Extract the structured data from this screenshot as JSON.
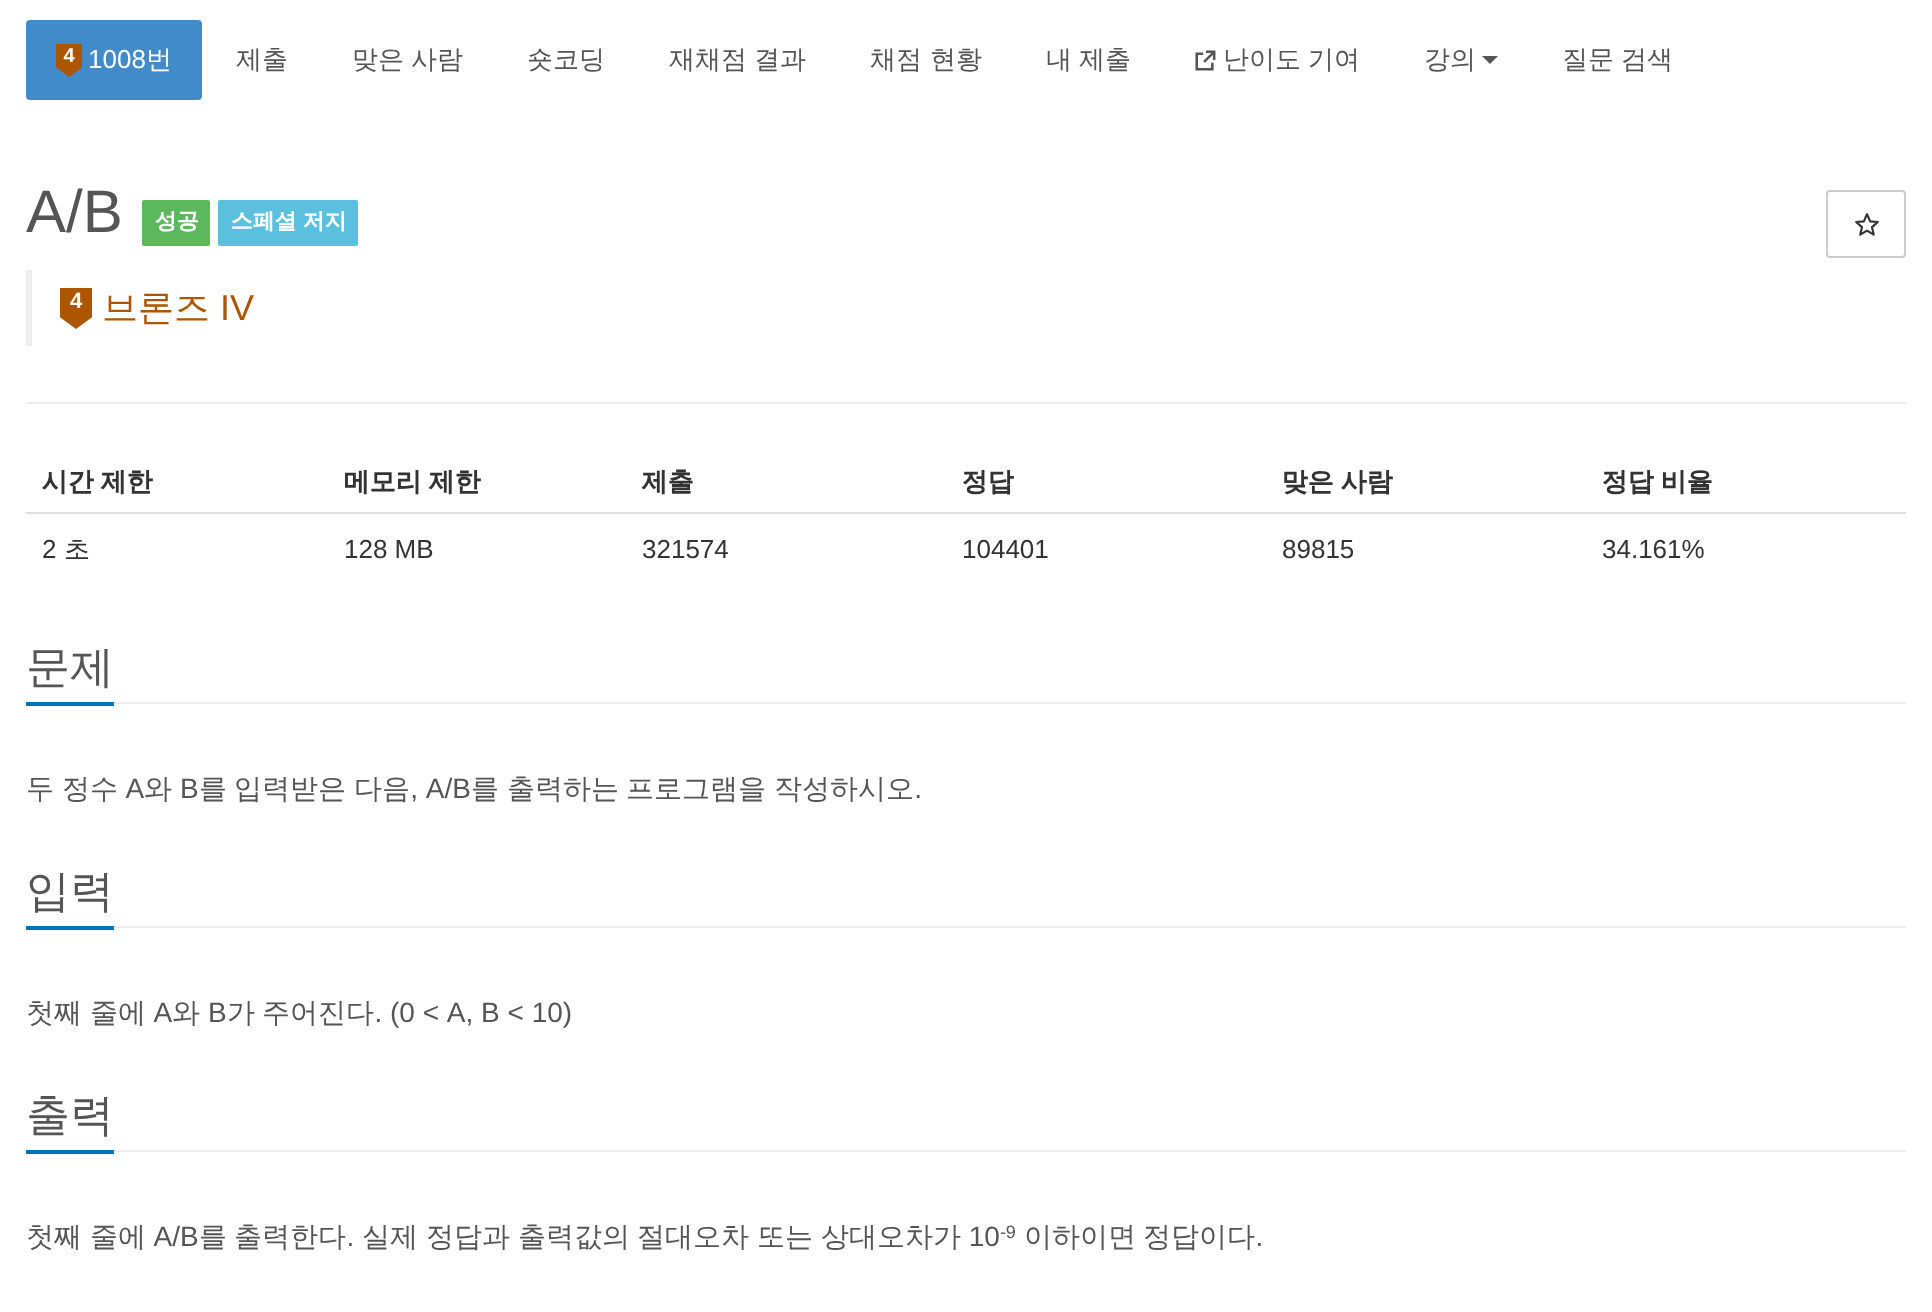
{
  "nav": {
    "items": [
      {
        "kind": "problem",
        "label": "1008번",
        "tier_digit": "4",
        "selected": true
      },
      {
        "kind": "plain",
        "label": "제출",
        "selected": false
      },
      {
        "kind": "plain",
        "label": "맞은 사람",
        "selected": false
      },
      {
        "kind": "plain",
        "label": "숏코딩",
        "selected": false
      },
      {
        "kind": "plain",
        "label": "재채점 결과",
        "selected": false
      },
      {
        "kind": "plain",
        "label": "채점 현황",
        "selected": false
      },
      {
        "kind": "plain",
        "label": "내 제출",
        "selected": false
      },
      {
        "kind": "external",
        "label": "난이도 기여",
        "selected": false
      },
      {
        "kind": "dropdown",
        "label": "강의",
        "selected": false
      },
      {
        "kind": "plain",
        "label": "질문 검색",
        "selected": false
      }
    ]
  },
  "problem": {
    "title": "A/B",
    "labels": [
      {
        "text": "성공",
        "color": "#5cb85c"
      },
      {
        "text": "스페셜 저지",
        "color": "#5bc0de"
      }
    ],
    "tier": {
      "digit": "4",
      "name": "브론즈 IV"
    }
  },
  "table": {
    "columns": [
      "시간 제한",
      "메모리 제한",
      "제출",
      "정답",
      "맞은 사람",
      "정답 비율"
    ],
    "rows": [
      [
        "2 초",
        "128 MB",
        "321574",
        "104401",
        "89815",
        "34.161%"
      ]
    ]
  },
  "sections": [
    {
      "heading": "문제",
      "body": "두 정수 A와 B를 입력받은 다음, A/B를 출력하는 프로그램을 작성하시오."
    },
    {
      "heading": "입력",
      "body": "첫째 줄에 A와 B가 주어진다. (0 < A, B < 10)"
    },
    {
      "heading": "출력",
      "body": "첫째 줄에 A/B를 출력한다. 실제 정답과 출력값의 절대오차 또는 상대오차가 10$^{-9}$ 이하이면 정답이다."
    }
  ]
}
